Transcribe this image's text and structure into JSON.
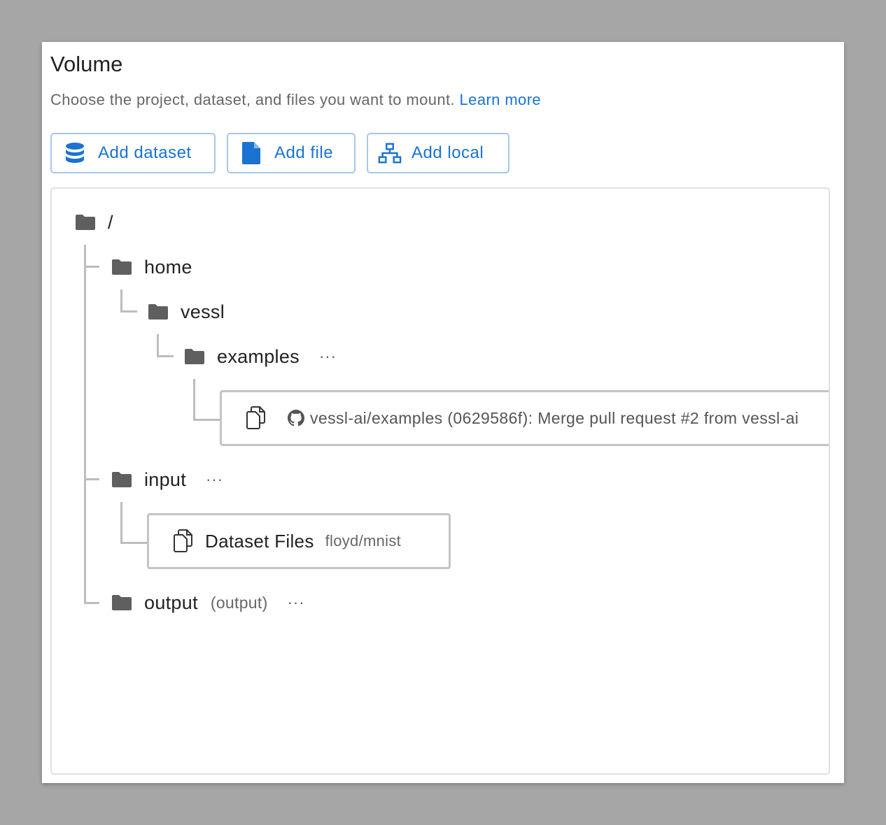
{
  "volume": {
    "title": "Volume",
    "description": "Choose the project, dataset, and files you want to mount.",
    "learn_more": "Learn more"
  },
  "buttons": {
    "add_dataset": "Add dataset",
    "add_file": "Add file",
    "add_local": "Add local"
  },
  "tree": {
    "root": "/",
    "home": "home",
    "vessl": "vessl",
    "examples": "examples",
    "examples_file": "vessl-ai/examples (0629586f): Merge pull request #2 from vessl-ai",
    "input": "input",
    "dataset_name": "Dataset Files",
    "dataset_source": "floyd/mnist",
    "output": "output",
    "output_aux": "(output)",
    "more": "···"
  },
  "colors": {
    "accent": "#1a73d1",
    "folder": "#5f5f5f",
    "tree_line": "#bdbdbd"
  }
}
